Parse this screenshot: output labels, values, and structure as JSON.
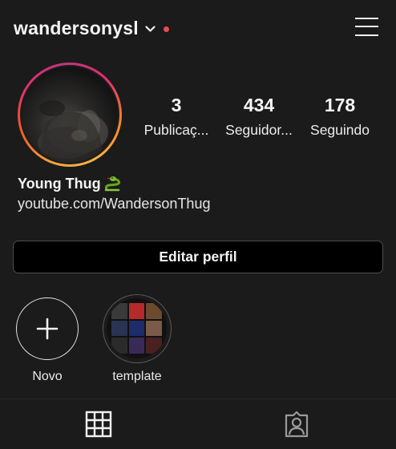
{
  "header": {
    "username": "wandersonysl",
    "dropdown_icon": "chevron-down-icon",
    "notification_color": "#ed4956",
    "menu_icon": "hamburger-menu-icon"
  },
  "profile": {
    "avatar_ring_colors": [
      "#f9a23a",
      "#e1306c",
      "#c13584"
    ],
    "stats": [
      {
        "value": "3",
        "label": "Publicaç..."
      },
      {
        "value": "434",
        "label": "Seguidor..."
      },
      {
        "value": "178",
        "label": "Seguindo"
      }
    ],
    "name": "Young Thug",
    "name_emoji": "snake-emoji",
    "link": "youtube.com/WandersonThug"
  },
  "edit_button": {
    "label": "Editar perfil"
  },
  "highlights": [
    {
      "label": "Novo",
      "icon": "plus-icon"
    },
    {
      "label": "template"
    }
  ],
  "tabs": [
    {
      "icon": "grid-icon",
      "active": true
    },
    {
      "icon": "tagged-person-icon",
      "active": false
    }
  ]
}
